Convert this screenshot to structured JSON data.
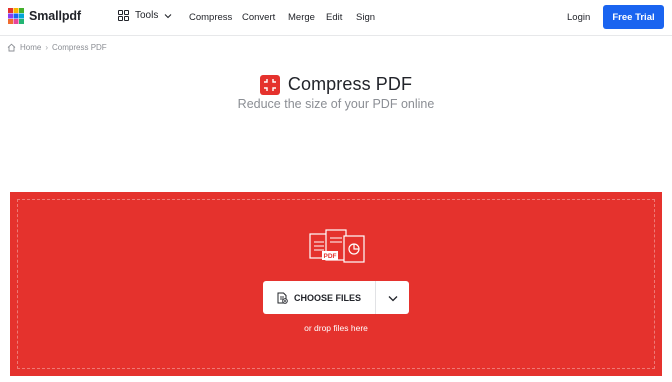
{
  "header": {
    "logo_text": "Smallpdf",
    "tools_label": "Tools",
    "nav": [
      "Compress",
      "Convert",
      "Merge",
      "Edit",
      "Sign"
    ],
    "login_label": "Login",
    "trial_label": "Free Trial"
  },
  "breadcrumb": {
    "home": "Home",
    "current": "Compress PDF"
  },
  "page": {
    "title": "Compress PDF",
    "subtitle": "Reduce the size of your PDF online"
  },
  "dropzone": {
    "choose_label": "CHOOSE FILES",
    "drop_hint": "or drop files here",
    "illustration_badge": "PDF"
  },
  "colors": {
    "brand_red": "#e5322d",
    "primary_blue": "#1a64f0",
    "text": "#22242a",
    "muted": "#8b8e94"
  },
  "icons": {
    "logo": "smallpdf-logo-icon",
    "tools": "grid-icon",
    "home": "home-icon",
    "compress": "compress-icon",
    "upload": "file-upload-icon",
    "more": "chevron-down-icon"
  }
}
